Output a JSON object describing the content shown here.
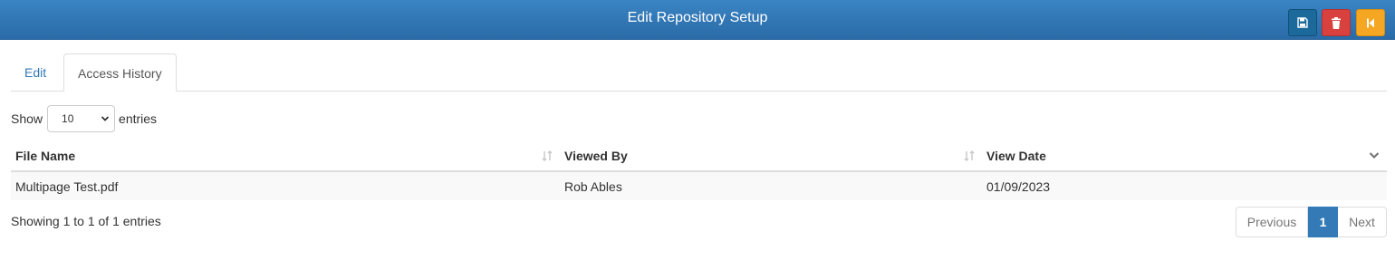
{
  "header": {
    "title": "Edit Repository Setup",
    "buttons": [
      {
        "icon": "save-icon",
        "color": "#1b6a9b"
      },
      {
        "icon": "trash-icon",
        "color": "#d9413f"
      },
      {
        "icon": "back-to-start-icon",
        "color": "#f5a623"
      }
    ]
  },
  "tabs": [
    {
      "label": "Edit",
      "active": false
    },
    {
      "label": "Access History",
      "active": true
    }
  ],
  "length_menu": {
    "prefix": "Show",
    "value": "10",
    "suffix": "entries"
  },
  "table": {
    "columns": [
      "File Name",
      "Viewed By",
      "View Date"
    ],
    "rows": [
      [
        "Multipage Test.pdf",
        "Rob Ables",
        "01/09/2023"
      ]
    ]
  },
  "info": "Showing 1 to 1 of 1 entries",
  "pagination": {
    "previous": "Previous",
    "current": "1",
    "next": "Next"
  },
  "colors": {
    "header": "#2f78b8",
    "link": "#337ab7",
    "active_page": "#337ab7"
  }
}
